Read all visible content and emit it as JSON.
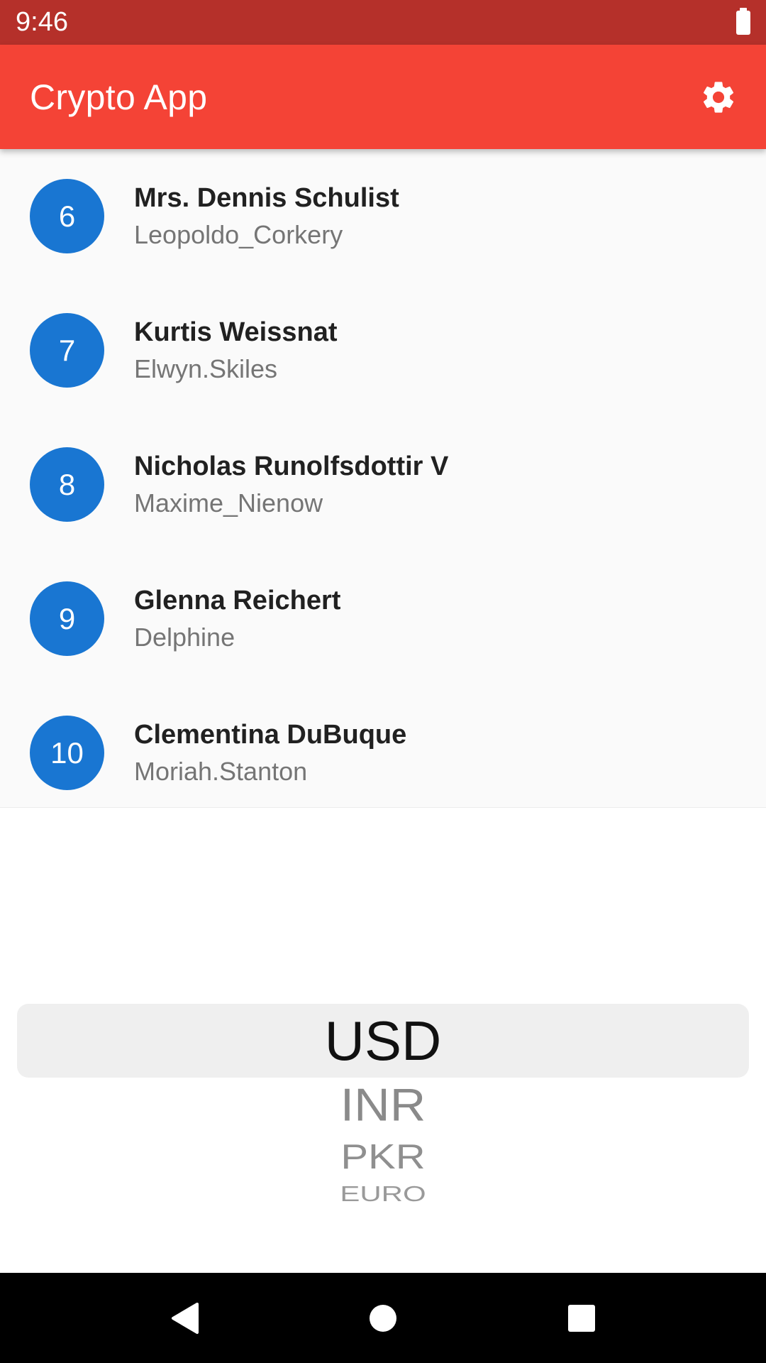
{
  "status_bar": {
    "time": "9:46",
    "battery_icon": "battery-full-icon"
  },
  "app_bar": {
    "title": "Crypto App",
    "settings_icon": "gear-icon",
    "color": "#F44336"
  },
  "list": {
    "items": [
      {
        "number": "6",
        "title": "Mrs. Dennis Schulist",
        "subtitle": "Leopoldo_Corkery"
      },
      {
        "number": "7",
        "title": "Kurtis Weissnat",
        "subtitle": "Elwyn.Skiles"
      },
      {
        "number": "8",
        "title": "Nicholas Runolfsdottir V",
        "subtitle": "Maxime_Nienow"
      },
      {
        "number": "9",
        "title": "Glenna Reichert",
        "subtitle": "Delphine"
      },
      {
        "number": "10",
        "title": "Clementina DuBuque",
        "subtitle": "Moriah.Stanton"
      }
    ],
    "avatar_color": "#1976D2"
  },
  "currency_picker": {
    "selected": "USD",
    "options": [
      "INR",
      "PKR",
      "EURO"
    ]
  },
  "nav_bar": {
    "back_icon": "back-triangle-icon",
    "home_icon": "home-circle-icon",
    "recents_icon": "recents-square-icon"
  }
}
